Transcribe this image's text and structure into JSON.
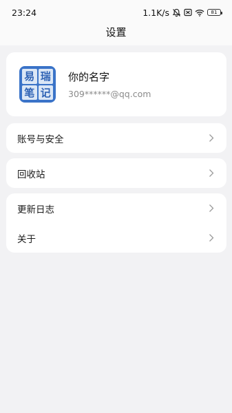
{
  "status_bar": {
    "time": "23:24",
    "network_speed": "1.1K/s",
    "battery": "81",
    "icons": [
      "mute-bell-icon",
      "sim-off-icon",
      "wifi-icon",
      "battery-icon"
    ]
  },
  "header": {
    "title": "设置"
  },
  "profile": {
    "logo_chars": [
      "易",
      "瑞",
      "笔",
      "记"
    ],
    "name": "你的名字",
    "email": "309******@qq.com"
  },
  "menu": {
    "account_security": "账号与安全",
    "recycle_bin": "回收站",
    "changelog": "更新日志",
    "about": "关于"
  },
  "colors": {
    "background": "#f2f2f4",
    "card": "#ffffff",
    "logo_blue": "#3a73c8",
    "secondary_text": "#8a8a8a"
  }
}
